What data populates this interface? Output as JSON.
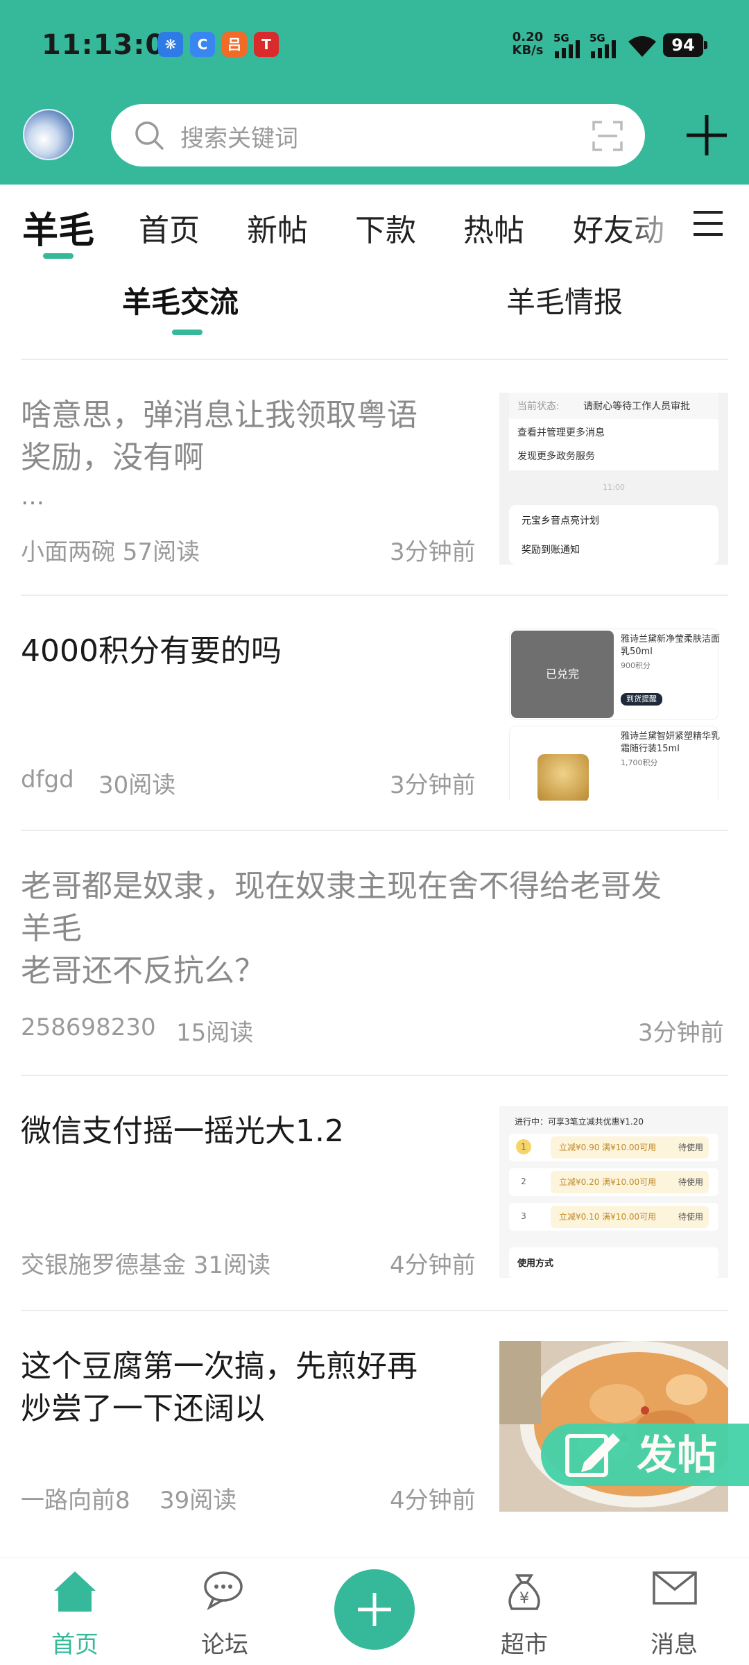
{
  "status_bar": {
    "time": "11:13:02",
    "net_speed_value": "0.20",
    "net_speed_unit": "KB/s",
    "signal_1": "5G",
    "signal_2": "5G",
    "battery": "94",
    "notification_icons": [
      "app-icon-blue",
      "app-icon-c",
      "app-icon-orange",
      "app-icon-red"
    ]
  },
  "header": {
    "search_placeholder": "搜索关键词"
  },
  "tabs": [
    "羊毛",
    "首页",
    "新帖",
    "下款",
    "热帖",
    "好友动"
  ],
  "subtabs": [
    "羊毛交流",
    "羊毛情报"
  ],
  "posts": [
    {
      "title_line1": "啥意思，弹消息让我领取粤语",
      "title_line2": "奖励，没有啊",
      "title_line3": "…",
      "meta": "小面两碗 57阅读",
      "time": "3分钟前"
    },
    {
      "title_line1": "4000积分有要的吗",
      "meta_author": "dfgd",
      "meta_reads": "30阅读",
      "time": "3分钟前"
    },
    {
      "title_line1": "老哥都是奴隶，现在奴隶主现在舍不得给老哥发",
      "title_line2": "羊毛",
      "title_line3": "老哥还不反抗么？",
      "meta_author": "258698230",
      "meta_reads": "15阅读",
      "time": "3分钟前"
    },
    {
      "title_line1": "微信支付摇一摇光大1.2",
      "meta": "交银施罗德基金 31阅读",
      "time": "4分钟前"
    },
    {
      "title_line1": "这个豆腐第一次搞，先煎好再",
      "title_line2": "炒尝了一下还阔以",
      "meta_author": "一路向前8",
      "meta_reads": "39阅读",
      "time": "4分钟前"
    }
  ],
  "thumb1": {
    "row1_label": "当前状态:",
    "row1_value": "请耐心等待工作人员审批",
    "row2": "查看并管理更多消息",
    "row3": "发现更多政务服务",
    "stamp": "11:00",
    "card_title": "元宝乡音点亮计划",
    "card_body": "奖励到账通知"
  },
  "thumb2": {
    "redeemed": "已兑完",
    "item1_name": "雅诗兰黛新净莹柔肤洁面乳50ml",
    "item1_points": "900积分",
    "item1_btn": "到货提醒",
    "item2_name": "雅诗兰黛智妍紧塑精华乳霜随行装15ml",
    "item2_points": "1,700积分"
  },
  "thumb3": {
    "header": "进行中：可享3笔立减共优惠¥1.20",
    "rows": [
      {
        "n": "1",
        "text": "立减¥0.90  满¥10.00可用",
        "status": "待使用"
      },
      {
        "n": "2",
        "text": "立减¥0.20  满¥10.00可用",
        "status": "待使用"
      },
      {
        "n": "3",
        "text": "立减¥0.10  满¥10.00可用",
        "status": "待使用"
      }
    ],
    "footer": "使用方式"
  },
  "fab": {
    "label": "发帖"
  },
  "bottom_nav": {
    "home": "首页",
    "forum": "论坛",
    "market": "超市",
    "messages": "消息"
  },
  "colors": {
    "accent": "#35b99a",
    "fab": "#45d2a9"
  }
}
